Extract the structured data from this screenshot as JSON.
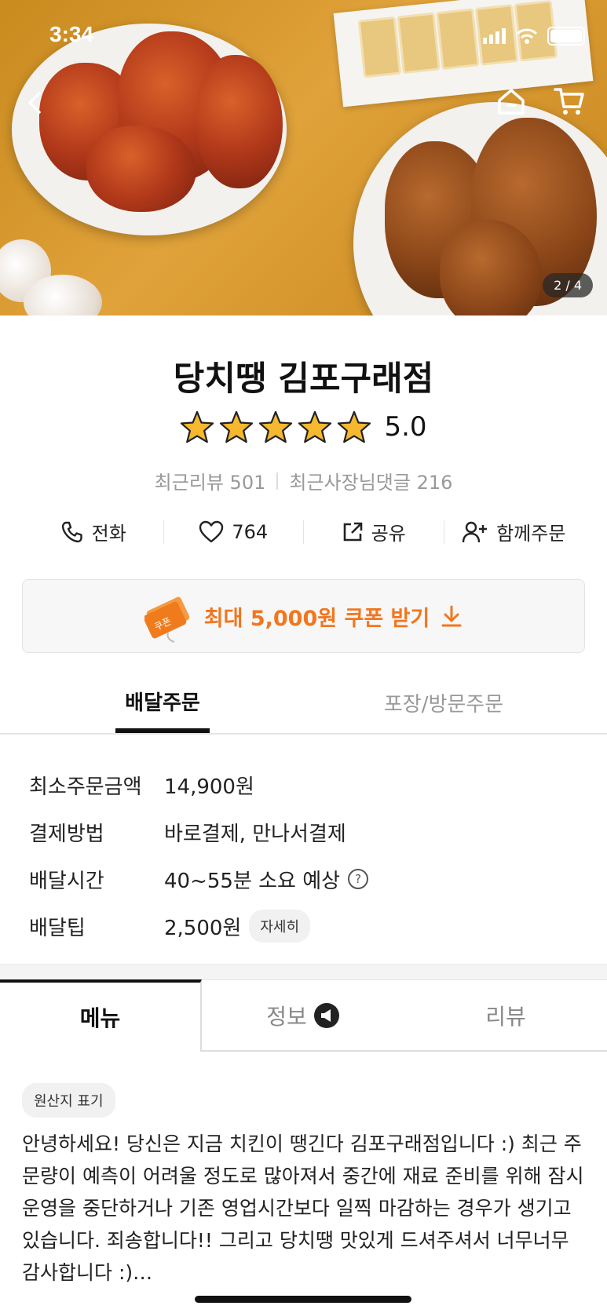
{
  "status_bar": {
    "time": "3:34"
  },
  "hero": {
    "counter": "2 / 4"
  },
  "store": {
    "name": "당치땡 김포구래점",
    "rating": "5.0",
    "stars": 5
  },
  "stats": {
    "reviews": "최근리뷰 501",
    "owner_replies": "최근사장님댓글 216"
  },
  "actions": {
    "call": "전화",
    "likes": "764",
    "share": "공유",
    "group_order": "함께주문"
  },
  "coupon": {
    "label": "최대 5,000원 쿠폰 받기",
    "icon_text": "쿠폰"
  },
  "order_tabs": {
    "delivery": "배달주문",
    "pickup": "포장/방문주문"
  },
  "info": {
    "min_order_label": "최소주문금액",
    "min_order_value": "14,900원",
    "payment_label": "결제방법",
    "payment_value": "바로결제, 만나서결제",
    "time_label": "배달시간",
    "time_value": "40~55분 소요 예상",
    "tip_label": "배달팁",
    "tip_value": "2,500원",
    "tip_detail": "자세히"
  },
  "main_tabs": {
    "menu": "메뉴",
    "info": "정보",
    "reviews": "리뷰"
  },
  "origin_chip": "원산지 표기",
  "notice": "안녕하세요! 당신은 지금 치킨이 땡긴다 김포구래점입니다 :) 최근 주문량이 예측이 어려울 정도로 많아져서 중간에 재료 준비를 위해 잠시 운영을 중단하거나 기존 영업시간보다 일찍 마감하는 경우가 생기고 있습니다. 죄송합니다!! 그리고 당치땡 맛있게 드셔주셔서 너무너무 감사합니다  :)…",
  "colors": {
    "accent": "#f1761f",
    "star": "#f5b82e"
  }
}
